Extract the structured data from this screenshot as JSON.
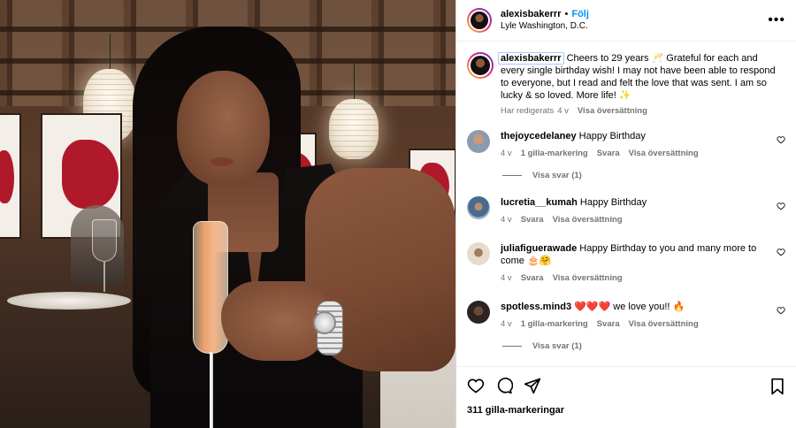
{
  "post": {
    "username": "alexisbakerrr",
    "follow_label": "Följ",
    "separator": "•",
    "location": "Lyle Washington, D.C."
  },
  "caption": {
    "username": "alexisbakerrr",
    "text": "Cheers to 29 years 🥂 Grateful for each and every single birthday wish! I may not have been able to respond to everyone, but I read and felt the love that was sent. I am so lucky & so loved. More life! ✨",
    "edited": "Har redigerats",
    "time": "4 v",
    "translate": "Visa översättning"
  },
  "comments": [
    {
      "username": "thejoycedelaney",
      "text": "Happy Birthday",
      "time": "4 v",
      "likes": "1 gilla-markering",
      "reply": "Svara",
      "translate": "Visa översättning",
      "view_replies": "Visa svar (1)",
      "avatar_color": "#8a9bb0"
    },
    {
      "username": "lucretia__kumah",
      "text": "Happy Birthday",
      "time": "4 v",
      "reply": "Svara",
      "translate": "Visa översättning",
      "avatar_color": "#5a6b8c"
    },
    {
      "username": "juliafiguerawade",
      "text": "Happy Birthday to you and many more to come 🎂🤗",
      "time": "4 v",
      "reply": "Svara",
      "translate": "Visa översättning",
      "avatar_color": "#c8b89a"
    },
    {
      "username": "spotless.mind3",
      "text": "❤️❤️❤️ we love you!! 🔥",
      "time": "4 v",
      "likes": "1 gilla-markering",
      "reply": "Svara",
      "translate": "Visa översättning",
      "view_replies": "Visa svar (1)",
      "avatar_color": "#3a3230"
    }
  ],
  "likes_count": "311 gilla-markeringar",
  "icons": {
    "more": "more-options-icon",
    "like": "heart-icon",
    "comment": "comment-icon",
    "share": "share-icon",
    "save": "bookmark-icon"
  }
}
